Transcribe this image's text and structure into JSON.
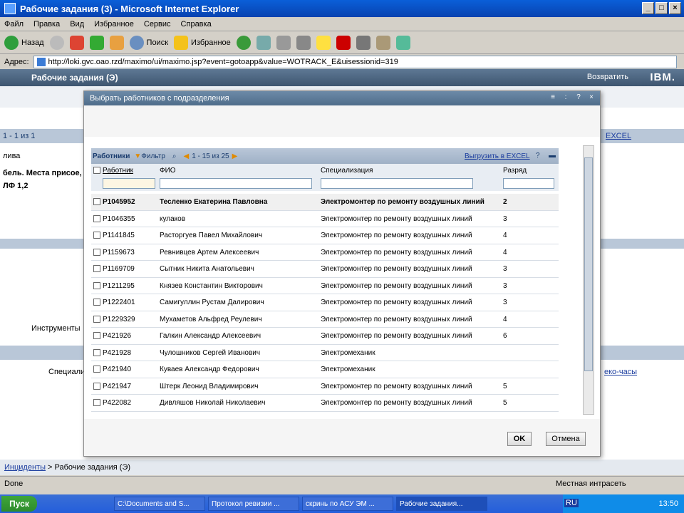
{
  "window": {
    "title": "Рабочие задания (3) - Microsoft Internet Explorer"
  },
  "menu": [
    "Файл",
    "Правка",
    "Вид",
    "Избранное",
    "Сервис",
    "Справка"
  ],
  "toolbar": {
    "back": "Назад",
    "search": "Поиск",
    "favorites": "Избранное"
  },
  "address": {
    "label": "Адрес:",
    "url": "http://loki.gvc.oao.rzd/maximo/ui/maximo.jsp?event=gotoapp&value=WOTRACK_E&uisessionid=319"
  },
  "app": {
    "title": "Рабочие задания (Э)",
    "return_label": "Возвратить",
    "ibm": "IBM."
  },
  "background": {
    "nav_count": "1 - 1 из 1",
    "excel": "EXCEL",
    "text1": "лива",
    "text2": "бель. Места присое,",
    "text3": "ЛФ 1,2",
    "tab_tools": "Инструменты",
    "spec": "Специали",
    "hours": "еко-часы",
    "breadcrumb1": "Инциденты",
    "breadcrumb2": "Рабочие задания (Э)"
  },
  "dialog": {
    "title": "Выбрать работников с подразделения",
    "table_title": "Работники",
    "filter_label": "Фильтр",
    "pager": "1 - 15 из 25",
    "export": "Выгрузить в EXCEL",
    "columns": [
      "Работник",
      "ФИО",
      "Специализация",
      "Разряд"
    ],
    "rows": [
      {
        "id": "P1045952",
        "name": "Тесленко Екатерина Павловна",
        "spec": "Электромонтер по ремонту воздушных линий",
        "grade": "2"
      },
      {
        "id": "P1046355",
        "name": "кулаков",
        "spec": "Электромонтер по ремонту воздушных линий",
        "grade": "3"
      },
      {
        "id": "P1141845",
        "name": "Расторгуев Павел Михайлович",
        "spec": "Электромонтер по ремонту воздушных линий",
        "grade": "4"
      },
      {
        "id": "P1159673",
        "name": "Ревнивцев Артем Алексеевич",
        "spec": "Электромонтер по ремонту воздушных линий",
        "grade": "4"
      },
      {
        "id": "P1169709",
        "name": "Сытник Никита Анатольевич",
        "spec": "Электромонтер по ремонту воздушных линий",
        "grade": "3"
      },
      {
        "id": "P1211295",
        "name": "Князев Константин Викторович",
        "spec": "Электромонтер по ремонту воздушных линий",
        "grade": "3"
      },
      {
        "id": "P1222401",
        "name": "Самигуллин Рустам Далирович",
        "spec": "Электромонтер по ремонту воздушных линий",
        "grade": "3"
      },
      {
        "id": "P1229329",
        "name": "Мухаметов Альфред Реулевич",
        "spec": "Электромонтер по ремонту воздушных линий",
        "grade": "4"
      },
      {
        "id": "P421926",
        "name": "Галкин Александр Алексеевич",
        "spec": "Электромонтер по ремонту воздушных линий",
        "grade": "6"
      },
      {
        "id": "P421928",
        "name": "Чулошников Сергей Иванович",
        "spec": "Электромеханик",
        "grade": ""
      },
      {
        "id": "P421940",
        "name": "Куваев Александр Федорович",
        "spec": "Электромеханик",
        "grade": ""
      },
      {
        "id": "P421947",
        "name": "Штерк Леонид Владимирович",
        "spec": "Электромонтер по ремонту воздушных линий",
        "grade": "5"
      },
      {
        "id": "P422082",
        "name": "Дивляшов Николай Николаевич",
        "spec": "Электромонтер по ремонту воздушных линий",
        "grade": "5"
      }
    ],
    "ok": "OK",
    "cancel": "Отмена"
  },
  "status": {
    "left": "Done",
    "zone": "Местная интрасеть"
  },
  "taskbar": {
    "start": "Пуск",
    "tasks": [
      "C:\\Documents and S...",
      "Протокол ревизии ...",
      "скринь по АСУ ЭМ ...",
      "Рабочие задания..."
    ],
    "lang": "RU",
    "clock": "13:50"
  }
}
